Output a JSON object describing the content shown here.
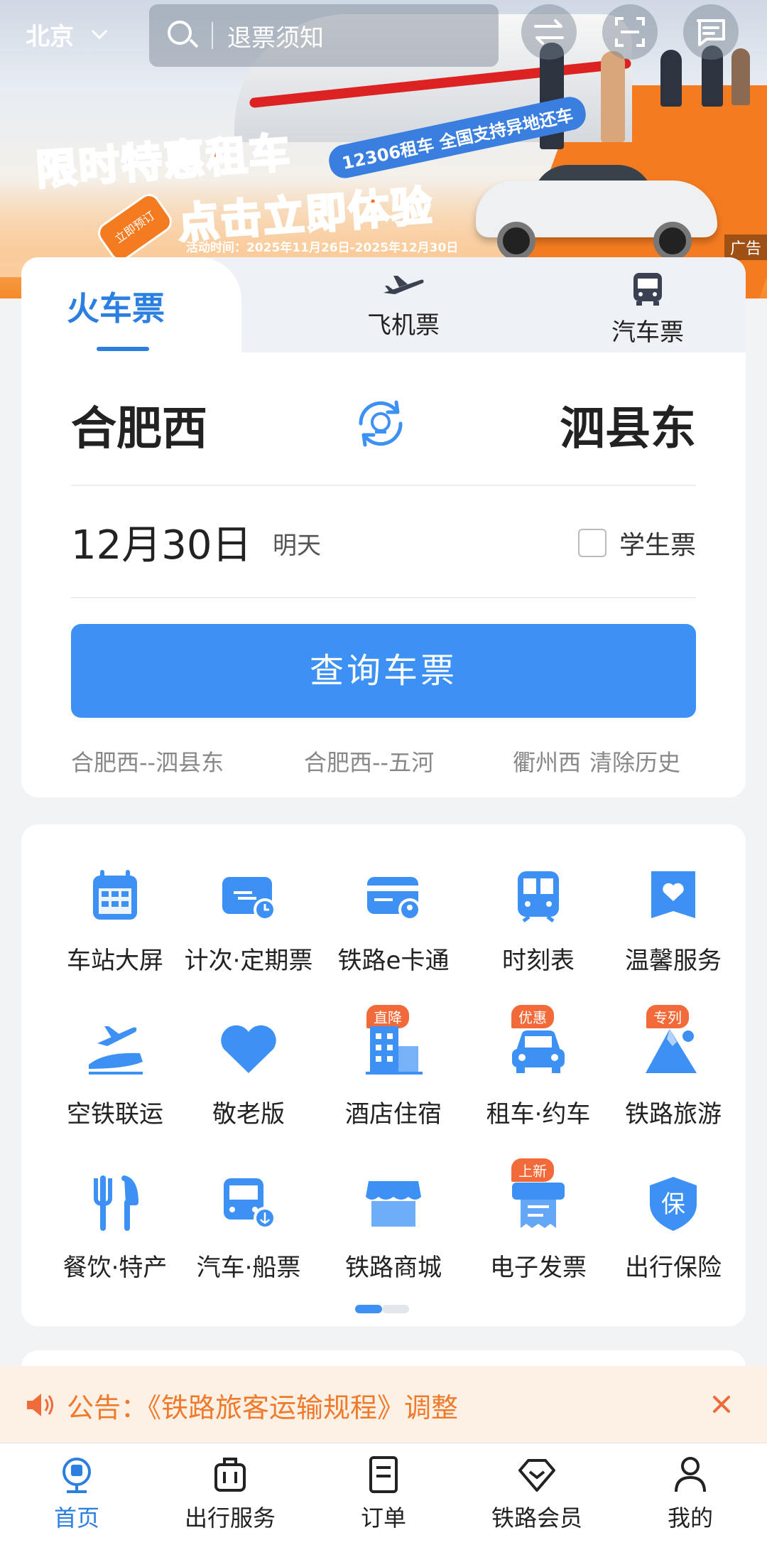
{
  "header": {
    "city": "北京",
    "search_placeholder": "退票须知"
  },
  "banner": {
    "title": "限时特惠租车",
    "subtitle": "点击立即体验",
    "pill": "12306租车 全国支持异地还车",
    "hand_label": "立即预订",
    "date_range": "活动时间：2025年11月26日-2025年12月30日",
    "ad_label": "广告"
  },
  "tabs": [
    {
      "label": "火车票",
      "icon": "train",
      "active": true
    },
    {
      "label": "飞机票",
      "icon": "plane-icon",
      "active": false
    },
    {
      "label": "汽车票",
      "icon": "bus-icon",
      "active": false
    }
  ],
  "query": {
    "from_station": "合肥西",
    "to_station": "泗县东",
    "date": "12月30日",
    "date_relative": "明天",
    "student_label": "学生票",
    "student_checked": false,
    "search_button": "查询车票",
    "history": [
      "合肥西--泗县东",
      "合肥西--五河",
      "衢州西"
    ],
    "clear_history": "清除历史"
  },
  "services": [
    {
      "label": "车站大屏",
      "icon": "calendar-icon",
      "badge": ""
    },
    {
      "label": "计次·定期票",
      "icon": "ticket-wallet-icon",
      "badge": ""
    },
    {
      "label": "铁路e卡通",
      "icon": "card-icon",
      "badge": ""
    },
    {
      "label": "时刻表",
      "icon": "train-front-icon",
      "badge": ""
    },
    {
      "label": "温馨服务",
      "icon": "heart-bag-icon",
      "badge": ""
    },
    {
      "label": "空铁联运",
      "icon": "plane-train-icon",
      "badge": ""
    },
    {
      "label": "敬老版",
      "icon": "heart-icon",
      "badge": ""
    },
    {
      "label": "酒店住宿",
      "icon": "building-icon",
      "badge": "直降"
    },
    {
      "label": "租车·约车",
      "icon": "car-icon",
      "badge": "优惠"
    },
    {
      "label": "铁路旅游",
      "icon": "mountain-icon",
      "badge": "专列"
    },
    {
      "label": "餐饮·特产",
      "icon": "fork-knife-icon",
      "badge": ""
    },
    {
      "label": "汽车·船票",
      "icon": "bus-anchor-icon",
      "badge": ""
    },
    {
      "label": "铁路商城",
      "icon": "shop-icon",
      "badge": ""
    },
    {
      "label": "电子发票",
      "icon": "invoice-icon",
      "badge": "上新"
    },
    {
      "label": "出行保险",
      "icon": "shield-icon",
      "badge": "",
      "glyph": "保"
    }
  ],
  "notice": {
    "text": "公告：《铁路旅客运输规程》调整"
  },
  "bottom_nav": [
    {
      "label": "首页",
      "icon": "home-rail-icon",
      "active": true
    },
    {
      "label": "出行服务",
      "icon": "luggage-icon",
      "active": false
    },
    {
      "label": "订单",
      "icon": "order-icon",
      "active": false
    },
    {
      "label": "铁路会员",
      "icon": "diamond-icon",
      "active": false
    },
    {
      "label": "我的",
      "icon": "user-icon",
      "active": false
    }
  ],
  "colors": {
    "accent": "#3d91f5",
    "tab_active": "#2b7fe0",
    "notice_text": "#f07a2b",
    "badge": "#f36a3a",
    "promo_orange": "#ff6d1a"
  }
}
